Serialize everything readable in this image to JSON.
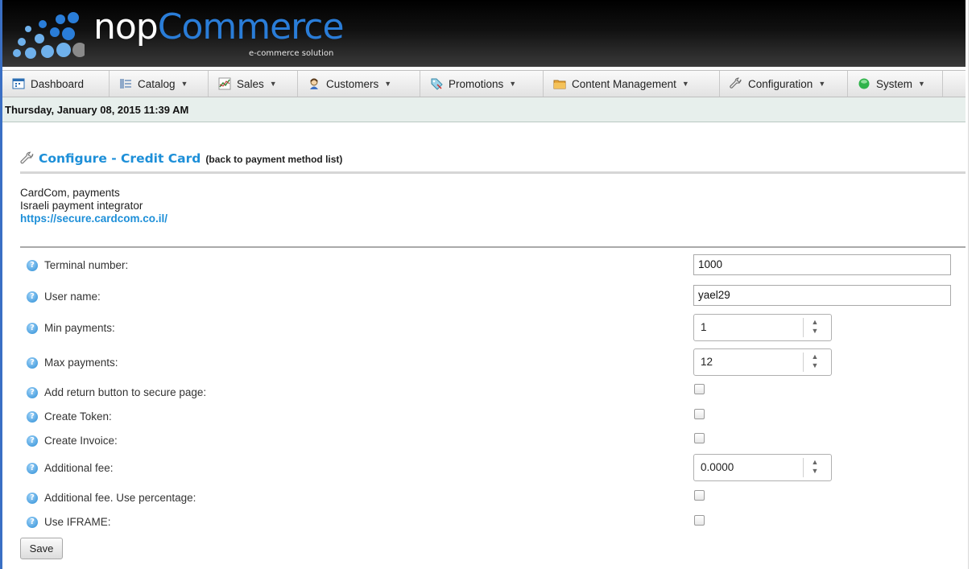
{
  "header": {
    "logo_nop": "nop",
    "logo_commerce": "Commerce",
    "logo_subtitle": "e-commerce solution"
  },
  "menu": {
    "items": [
      {
        "label": "Dashboard",
        "icon": "dashboard-icon",
        "has_caret": false
      },
      {
        "label": "Catalog",
        "icon": "catalog-icon",
        "has_caret": true
      },
      {
        "label": "Sales",
        "icon": "sales-chart-icon",
        "has_caret": true
      },
      {
        "label": "Customers",
        "icon": "customer-icon",
        "has_caret": true
      },
      {
        "label": "Promotions",
        "icon": "tag-icon",
        "has_caret": true
      },
      {
        "label": "Content Management",
        "icon": "folder-icon",
        "has_caret": true
      },
      {
        "label": "Configuration",
        "icon": "wrench-icon",
        "has_caret": true
      },
      {
        "label": "System",
        "icon": "green-status-icon",
        "has_caret": true
      }
    ],
    "caret": "▼"
  },
  "date_bar": {
    "text": "Thursday, January 08, 2015 11:39 AM"
  },
  "page": {
    "title": "Configure - Credit Card",
    "back_link": "(back to payment method list)",
    "description_line1": "CardCom, payments",
    "description_line2": "Israeli payment integrator",
    "link": "https://secure.cardcom.co.il/"
  },
  "form": {
    "terminal_number": {
      "label": "Terminal number:",
      "value": "1000"
    },
    "user_name": {
      "label": "User name:",
      "value": "yael29"
    },
    "min_payments": {
      "label": "Min payments:",
      "value": "1"
    },
    "max_payments": {
      "label": "Max payments:",
      "value": "12"
    },
    "add_return_button": {
      "label": "Add return button to secure page:",
      "checked": false
    },
    "create_token": {
      "label": "Create Token:",
      "checked": false
    },
    "create_invoice": {
      "label": "Create Invoice:",
      "checked": false
    },
    "additional_fee": {
      "label": "Additional fee:",
      "value": "0.0000"
    },
    "additional_fee_percentage": {
      "label": "Additional fee. Use percentage:",
      "checked": false
    },
    "use_iframe": {
      "label": "Use IFRAME:",
      "checked": false
    },
    "help_glyph": "?",
    "spin_up": "▲",
    "spin_down": "▼",
    "save_label": "Save"
  }
}
